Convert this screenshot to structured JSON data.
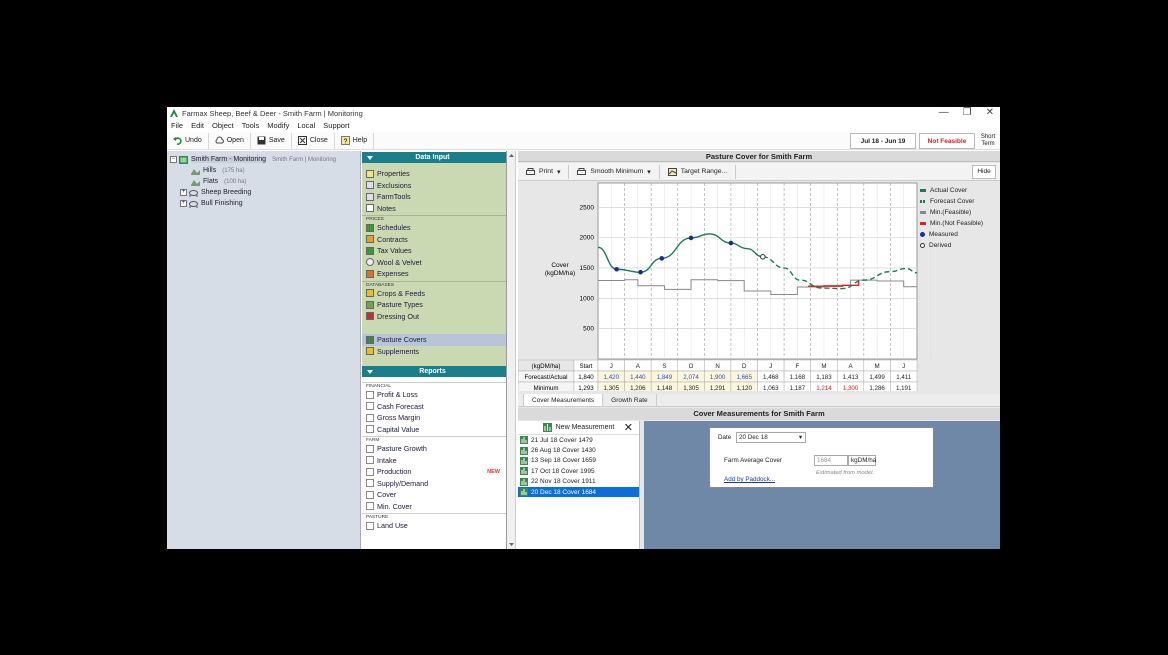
{
  "window": {
    "title": "Farmax Sheep, Beef & Deer - Smith Farm | Monitoring",
    "controls": [
      "—",
      "❐",
      "✕"
    ]
  },
  "menu": [
    "File",
    "Edit",
    "Object",
    "Tools",
    "Modify",
    "Local",
    "Support"
  ],
  "toolbar": {
    "undo": "Undo",
    "open": "Open",
    "save": "Save",
    "close": "Close",
    "help": "Help",
    "date_range": "Jul 18 - Jun 19",
    "feasibility": "Not Feasible",
    "short_term": "Short Term"
  },
  "tree": [
    {
      "label": "Smith Farm - Monitoring",
      "sub": "Smith Farm | Monitoring",
      "level": 0
    },
    {
      "label": "Hills",
      "sub": "(175 ha)",
      "level": 1
    },
    {
      "label": "Flats",
      "sub": "(100 ha)",
      "level": 1
    },
    {
      "label": "Sheep Breeding",
      "sub": "",
      "level": 1
    },
    {
      "label": "Bull Finishing",
      "sub": "",
      "level": 1
    }
  ],
  "data_input": {
    "title": "Data Input",
    "items1": [
      "Properties",
      "Exclusions",
      "FarmTools",
      "Notes"
    ],
    "group_prices": "PRICES",
    "items2": [
      "Schedules",
      "Contracts",
      "Tax Values",
      "Wool & Velvet",
      "Expenses"
    ],
    "group_databases": "DATABASES",
    "items3": [
      "Crops & Feeds",
      "Pasture Types",
      "Dressing Out"
    ],
    "items4": [
      "Pasture Covers",
      "Supplements"
    ]
  },
  "reports": {
    "title": "Reports",
    "group_financial": "FINANCIAL",
    "items1": [
      "Profit & Loss",
      "Cash Forecast",
      "Gross Margin",
      "Capital Value"
    ],
    "group_farm": "FARM",
    "items2": [
      "Pasture Growth",
      "Intake",
      "Production",
      "Supply/Demand",
      "Cover",
      "Min. Cover"
    ],
    "new_tag": "NEW",
    "group_pasture": "PASTURE",
    "items3": [
      "Land Use"
    ]
  },
  "chart_panel": {
    "title": "Pasture Cover for Smith Farm",
    "print": "Print",
    "smooth": "Smooth Minimum",
    "target": "Target Range...",
    "hide": "Hide"
  },
  "chart_data": {
    "type": "line",
    "ylabel": "Cover (kgDM/ha)",
    "yticks": [
      500,
      1000,
      1500,
      2000,
      2500
    ],
    "ylim": [
      0,
      2900
    ],
    "months": [
      "J",
      "A",
      "S",
      "O",
      "N",
      "D",
      "J",
      "F",
      "M",
      "A",
      "M",
      "J"
    ],
    "series": [
      {
        "name": "Actual Cover",
        "color": "#1a7a5a",
        "style": "solid"
      },
      {
        "name": "Forecast Cover",
        "color": "#1a7a5a",
        "style": "dashed"
      },
      {
        "name": "Min.(Feasible)",
        "color": "#888888",
        "style": "solid"
      },
      {
        "name": "Min.(Not Feasible)",
        "color": "#e02020",
        "style": "solid"
      },
      {
        "name": "Measured",
        "color": "#1a2a9a",
        "style": "dot"
      },
      {
        "name": "Derived",
        "color": "#333333",
        "style": "circle"
      }
    ],
    "actual": [
      [
        0,
        1840
      ],
      [
        0.7,
        1479
      ],
      [
        1.6,
        1430
      ],
      [
        2.4,
        1659
      ],
      [
        3.5,
        1995
      ],
      [
        4.2,
        2060
      ],
      [
        5.0,
        1911
      ],
      [
        5.6,
        1820
      ],
      [
        6.2,
        1684
      ]
    ],
    "forecast": [
      [
        6.2,
        1684
      ],
      [
        7.0,
        1500
      ],
      [
        7.6,
        1300
      ],
      [
        8.4,
        1170
      ],
      [
        9.2,
        1160
      ],
      [
        10.0,
        1300
      ],
      [
        11.0,
        1440
      ],
      [
        11.6,
        1490
      ],
      [
        12,
        1420
      ]
    ],
    "minimum": [
      [
        0,
        1293
      ],
      [
        1.0,
        1305
      ],
      [
        1.5,
        1206
      ],
      [
        2.5,
        1148
      ],
      [
        3.5,
        1305
      ],
      [
        4.5,
        1291
      ],
      [
        5.5,
        1120
      ],
      [
        6.5,
        1063
      ],
      [
        7.5,
        1187
      ],
      [
        8.5,
        1214
      ],
      [
        9.5,
        1300
      ],
      [
        10.5,
        1286
      ],
      [
        11.5,
        1191
      ],
      [
        12,
        1191
      ]
    ],
    "not_feasible": [
      [
        7.9,
        1200
      ],
      [
        9.2,
        1214
      ],
      [
        9.8,
        1300
      ]
    ],
    "measured": [
      [
        0.7,
        1479
      ],
      [
        1.6,
        1430
      ],
      [
        2.4,
        1659
      ],
      [
        3.5,
        1995
      ],
      [
        5.0,
        1911
      ]
    ],
    "derived": [
      [
        6.2,
        1684
      ]
    ],
    "table": {
      "header": "(kgDM/ha)",
      "start_label": "Start",
      "rows": [
        {
          "label": "Forecast/Actual",
          "start": "1,840",
          "values": [
            "1,420",
            "1,440",
            "1,849",
            "2,074",
            "1,900",
            "1,665",
            "1,468",
            "1,168",
            "1,183",
            "1,413",
            "1,499",
            "1,411"
          ]
        },
        {
          "label": "Minimum",
          "start": "1,293",
          "values": [
            "1,305",
            "1,206",
            "1,148",
            "1,305",
            "1,291",
            "1,120",
            "1,063",
            "1,187",
            "1,214",
            "1,300",
            "1,286",
            "1,191"
          ]
        }
      ]
    }
  },
  "tabs": [
    "Cover Measurements",
    "Growth Rate"
  ],
  "cover_measurements": {
    "title": "Cover Measurements for Smith Farm",
    "new_button": "New Measurement",
    "close": "✕",
    "list": [
      "21 Jul 18 Cover 1479",
      "26 Aug 18 Cover 1430",
      "13 Sep 18 Cover 1659",
      "17 Oct 18 Cover 1995",
      "22 Nov 18 Cover 1911",
      "20 Dec 18 Cover 1684"
    ],
    "selected_index": 5,
    "date_label": "Date",
    "date_value": "20 Dec 18",
    "avg_label": "Farm Average Cover",
    "avg_value": "1684",
    "unit": "kgDM/ha",
    "note": "Estimated from model.",
    "link": "Add by Paddock..."
  }
}
